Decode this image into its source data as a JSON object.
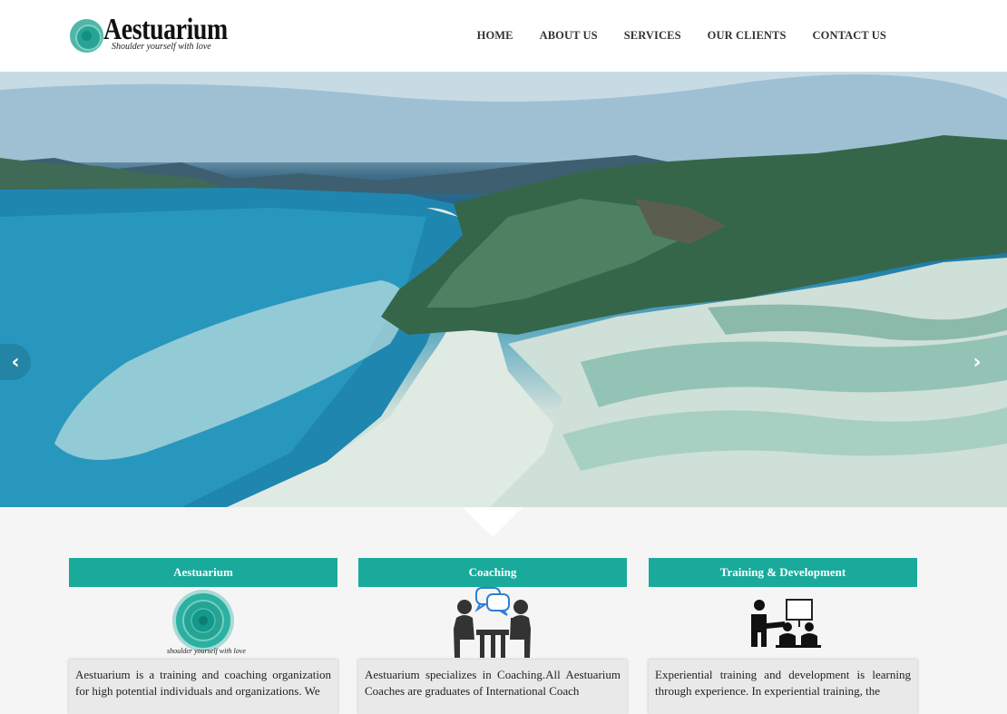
{
  "brand": {
    "name": "Aestuarium",
    "tagline": "Shoulder yourself with love"
  },
  "nav": {
    "items": [
      "HOME",
      "ABOUT US",
      "SERVICES",
      "OUR CLIENTS",
      "CONTACT US"
    ]
  },
  "slider": {
    "prev_icon": "‹",
    "next_icon": "›"
  },
  "cards": [
    {
      "title": "Aestuarium",
      "icon": "aestuarium-seal-icon",
      "icon_caption": "shoulder yourself with love",
      "text": "Aestuarium is a training and coaching organization for high potential individuals and organizations. We"
    },
    {
      "title": "Coaching",
      "icon": "coaching-conversation-icon",
      "text": "Aestuarium specializes in Coaching.All Aestuarium Coaches are graduates of International Coach"
    },
    {
      "title": "Training & Development",
      "icon": "training-presentation-icon",
      "text": "Experiential training and development is learning through experience. In experiential training, the"
    }
  ],
  "colors": {
    "accent": "#1aaa9b",
    "header_bg": "#ffffff",
    "page_bg": "#f5f5f5"
  }
}
